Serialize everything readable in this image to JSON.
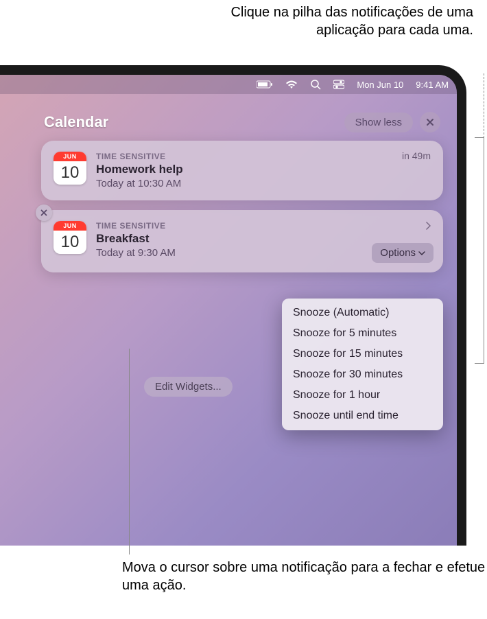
{
  "callouts": {
    "top": "Clique na pilha das notificações de uma aplicação para cada uma.",
    "bottom": "Mova o cursor sobre uma notificação para a fechar e efetue uma ação."
  },
  "menubar": {
    "date": "Mon Jun 10",
    "time": "9:41 AM"
  },
  "notifications": {
    "app_title": "Calendar",
    "show_less": "Show less",
    "items": [
      {
        "icon_month": "JUN",
        "icon_day": "10",
        "tag": "TIME SENSITIVE",
        "title": "Homework help",
        "subtitle": "Today at 10:30 AM",
        "right": "in 49m"
      },
      {
        "icon_month": "JUN",
        "icon_day": "10",
        "tag": "TIME SENSITIVE",
        "title": "Breakfast",
        "subtitle": "Today at 9:30 AM",
        "options_label": "Options"
      }
    ]
  },
  "dropdown": {
    "items": [
      "Snooze (Automatic)",
      "Snooze for 5 minutes",
      "Snooze for 15 minutes",
      "Snooze for 30 minutes",
      "Snooze for 1 hour",
      "Snooze until end time"
    ]
  },
  "edit_widgets": "Edit Widgets..."
}
